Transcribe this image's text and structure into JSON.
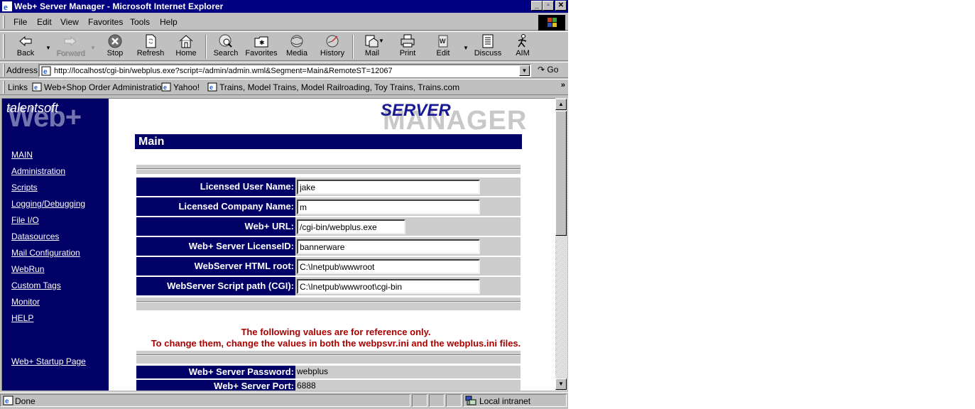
{
  "window": {
    "title": "Web+ Server Manager - Microsoft Internet Explorer",
    "controls": {
      "minimize": "_",
      "restore": "▫",
      "close": "✕"
    }
  },
  "menu": [
    "File",
    "Edit",
    "View",
    "Favorites",
    "Tools",
    "Help"
  ],
  "toolbar": {
    "buttons": [
      {
        "label": "Back",
        "icon": "back-arrow-icon",
        "enabled": true
      },
      {
        "label": "Forward",
        "icon": "forward-arrow-icon",
        "enabled": false
      },
      {
        "label": "Stop",
        "icon": "stop-icon",
        "enabled": true
      },
      {
        "label": "Refresh",
        "icon": "refresh-icon",
        "enabled": true
      },
      {
        "label": "Home",
        "icon": "home-icon",
        "enabled": true
      },
      {
        "label": "Search",
        "icon": "search-icon",
        "enabled": true
      },
      {
        "label": "Favorites",
        "icon": "favorites-icon",
        "enabled": true
      },
      {
        "label": "Media",
        "icon": "media-icon",
        "enabled": true
      },
      {
        "label": "History",
        "icon": "history-icon",
        "enabled": true
      },
      {
        "label": "Mail",
        "icon": "mail-icon",
        "enabled": true
      },
      {
        "label": "Print",
        "icon": "print-icon",
        "enabled": true
      },
      {
        "label": "Edit",
        "icon": "edit-icon",
        "enabled": true
      },
      {
        "label": "Discuss",
        "icon": "discuss-icon",
        "enabled": true
      },
      {
        "label": "AIM",
        "icon": "aim-icon",
        "enabled": true
      }
    ]
  },
  "address": {
    "label": "Address",
    "url": "http://localhost/cgi-bin/webplus.exe?script=/admin/admin.wml&Segment=Main&RemoteST=12067",
    "go_label": "Go"
  },
  "links": {
    "label": "Links",
    "items": [
      "Web+Shop Order Administration",
      "Yahoo!",
      "Trains, Model Trains, Model Railroading, Toy Trains, Trains.com"
    ],
    "more": "»"
  },
  "page": {
    "logo_brand": "talentsoft",
    "logo_product": "Web+",
    "header_server": "SERVER",
    "header_manager": "MANAGER",
    "section_title": "Main",
    "nav": [
      "MAIN",
      "Administration",
      "Scripts",
      "Logging/Debugging",
      "File I/O",
      "Datasources",
      "Mail Configuration",
      "WebRun",
      "Custom Tags",
      "Monitor",
      "HELP"
    ],
    "nav_startup": "Web+ Startup Page",
    "fields": [
      {
        "label": "Licensed User Name:",
        "value": "jake"
      },
      {
        "label": "Licensed Company Name:",
        "value": "m"
      },
      {
        "label": "Web+ URL:",
        "value": "/cgi-bin/webplus.exe"
      },
      {
        "label": "Web+ Server LicenseID:",
        "value": "bannerware"
      },
      {
        "label": "WebServer HTML root:",
        "value": "C:\\Inetpub\\wwwroot"
      },
      {
        "label": "WebServer Script path (CGI):",
        "value": "C:\\Inetpub\\wwwroot\\cgi-bin"
      }
    ],
    "notice_line1": "The following values are for reference only.",
    "notice_line2": "To change them, change the values in both the webpsvr.ini and the webplus.ini files.",
    "readonly": [
      {
        "label": "Web+ Server Password:",
        "value": "webplus"
      },
      {
        "label": "Web+ Server Port:",
        "value": "6888"
      }
    ]
  },
  "status": {
    "text": "Done",
    "zone": "Local intranet"
  },
  "scroll": {
    "position_fraction": 0.0,
    "visible_fraction": 0.45
  },
  "colors": {
    "nav_bg": "#000066",
    "title_bg": "#000080",
    "notice": "#aa0000",
    "chrome": "#c0c0c0"
  }
}
